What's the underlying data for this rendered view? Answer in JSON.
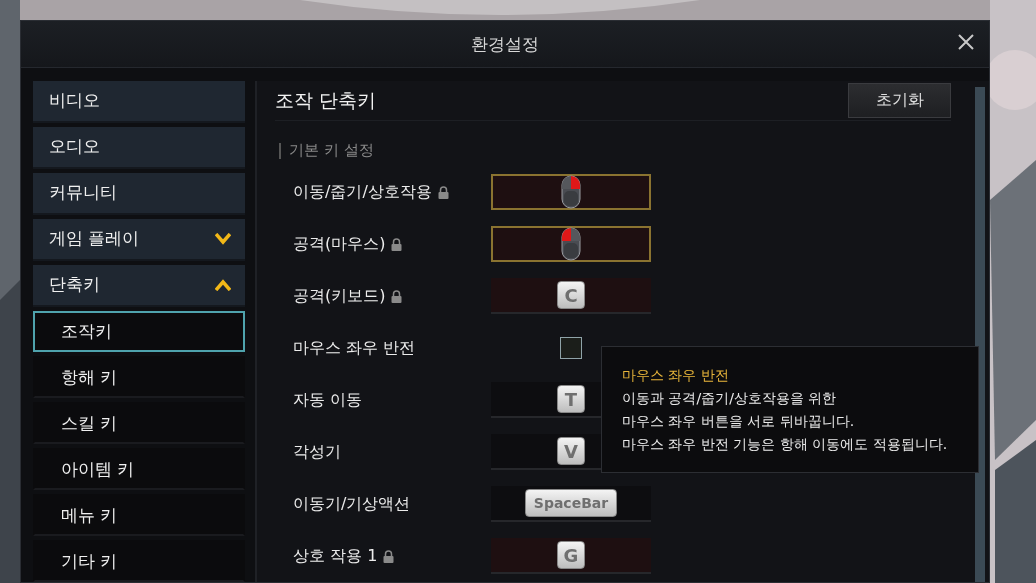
{
  "window": {
    "title": "환경설정"
  },
  "sidebar": {
    "items": [
      {
        "label": "비디오",
        "kind": "plain"
      },
      {
        "label": "오디오",
        "kind": "plain"
      },
      {
        "label": "커뮤니티",
        "kind": "plain"
      },
      {
        "label": "게임 플레이",
        "kind": "expandable",
        "expanded": false
      },
      {
        "label": "단축키",
        "kind": "expandable",
        "expanded": true,
        "children": [
          {
            "label": "조작키",
            "selected": true
          },
          {
            "label": "항해 키",
            "selected": false
          },
          {
            "label": "스킬 키",
            "selected": false
          },
          {
            "label": "아이템 키",
            "selected": false
          },
          {
            "label": "메뉴 키",
            "selected": false
          },
          {
            "label": "기타 키",
            "selected": false
          }
        ]
      }
    ]
  },
  "content": {
    "title": "조작 단축키",
    "reset_button": "초기화",
    "section": "기본 키 설정",
    "rows": [
      {
        "label": "이동/줍기/상호작용",
        "locked": true,
        "highlighted": true,
        "kind": "mouse",
        "left_pressed": false,
        "right_pressed": true
      },
      {
        "label": "공격(마우스)",
        "locked": true,
        "highlighted": true,
        "kind": "mouse",
        "left_pressed": true,
        "right_pressed": false
      },
      {
        "label": "공격(키보드)",
        "locked": true,
        "highlighted": false,
        "kind": "key",
        "key": "C"
      },
      {
        "label": "마우스 좌우 반전",
        "kind": "checkbox",
        "checked": false
      },
      {
        "label": "자동 이동",
        "locked": false,
        "highlighted": false,
        "kind": "key",
        "key": "T"
      },
      {
        "label": "각성기",
        "locked": false,
        "highlighted": false,
        "kind": "key",
        "key": "V"
      },
      {
        "label": "이동기/기상액션",
        "locked": false,
        "highlighted": false,
        "kind": "key",
        "key": "SpaceBar"
      },
      {
        "label": "상호 작용 1",
        "locked": true,
        "highlighted": false,
        "kind": "key",
        "key": "G"
      }
    ]
  },
  "tooltip": {
    "title": "마우스 좌우 반전",
    "lines": [
      "이동과 공격/줍기/상호작용을 위한",
      "마우스 좌우 버튼을 서로 뒤바꿉니다.",
      "마우스 좌우 반전 기능은 항해 이동에도 적용됩니다."
    ]
  }
}
